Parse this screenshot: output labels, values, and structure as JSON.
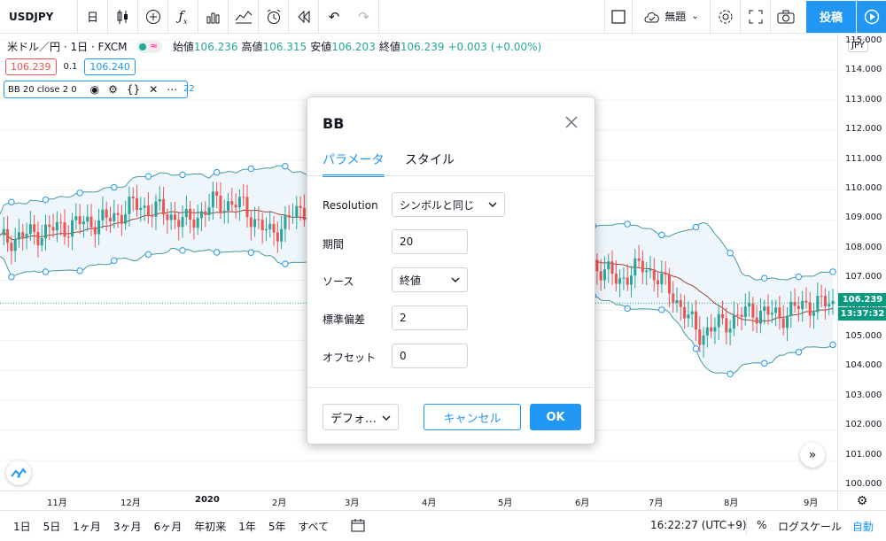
{
  "toolbar": {
    "symbol": "USDJPY",
    "interval": "日",
    "save_label": "無題",
    "publish_label": "投稿"
  },
  "legend": {
    "symbol_line": "米ドル／円 · 1日 · FXCM",
    "pill_symbol": "≈",
    "open_label": "始値",
    "open_value": "106.236",
    "high_label": "高値",
    "high_value": "106.315",
    "low_label": "安値",
    "low_value": "106.203",
    "close_label": "終値",
    "close_value": "106.239",
    "change": "+0.003 (+0.00%)",
    "bid": "106.239",
    "spread": "0.1",
    "ask": "106.240",
    "indicator": "BB 20 close 2 0",
    "indicator_overflow": "22"
  },
  "price_axis": {
    "currency": "JPY",
    "ticks": [
      "115.000",
      "114.000",
      "113.000",
      "112.000",
      "111.000",
      "110.000",
      "109.000",
      "108.000",
      "107.000",
      "106.000",
      "105.000",
      "104.000",
      "103.000",
      "102.000",
      "101.000",
      "100.000"
    ],
    "last_price": "106.239",
    "countdown": "13:37:32"
  },
  "time_axis": {
    "labels": [
      "11月",
      "12月",
      "2020",
      "2月",
      "3月",
      "4月",
      "5月",
      "6月",
      "7月",
      "8月",
      "9月"
    ]
  },
  "bottom": {
    "ranges": [
      "1日",
      "5日",
      "1ヶ月",
      "3ヶ月",
      "6ヶ月",
      "年初来",
      "1年",
      "5年",
      "すべて"
    ],
    "clock": "16:22:27 (UTC+9)",
    "percent": "%",
    "log": "ログスケール",
    "auto": "自動"
  },
  "dialog": {
    "title": "BB",
    "tab_params": "パラメータ",
    "tab_style": "スタイル",
    "resolution_label": "Resolution",
    "resolution_value": "シンボルと同じ",
    "period_label": "期間",
    "period_value": "20",
    "source_label": "ソース",
    "source_value": "終値",
    "stddev_label": "標準偏差",
    "stddev_value": "2",
    "offset_label": "オフセット",
    "offset_value": "0",
    "defaults_label": "デフォ…",
    "cancel_label": "キャンセル",
    "ok_label": "OK"
  },
  "colors": {
    "accent": "#2196f3",
    "up": "#26a69a",
    "down": "#ef5350",
    "band": "#4a9a9a",
    "band_fill": "#eef6fb",
    "basis": "#a0453d"
  },
  "chart_data": {
    "type": "candlestick",
    "indicator": "Bollinger Bands (20, close, 2, 0)",
    "x_labels": [
      "11月",
      "12月",
      "2020",
      "2月",
      "3月",
      "4月",
      "5月",
      "6月",
      "7月",
      "8月",
      "9月"
    ],
    "ylim": [
      100,
      115
    ],
    "last_close": 106.239,
    "close_approx": [
      108.3,
      108.5,
      108.7,
      108.9,
      109.0,
      109.5,
      109.3,
      108.9,
      109.6,
      109.5,
      108.5,
      109.2,
      109.8,
      110.0,
      109.5,
      107.7,
      110.6,
      109.1,
      107.4,
      107.8,
      107.4,
      107.8,
      107.6,
      107.0,
      107.5,
      106.6,
      105.2,
      105.6,
      106.0,
      105.8,
      106.2,
      106.2
    ]
  }
}
